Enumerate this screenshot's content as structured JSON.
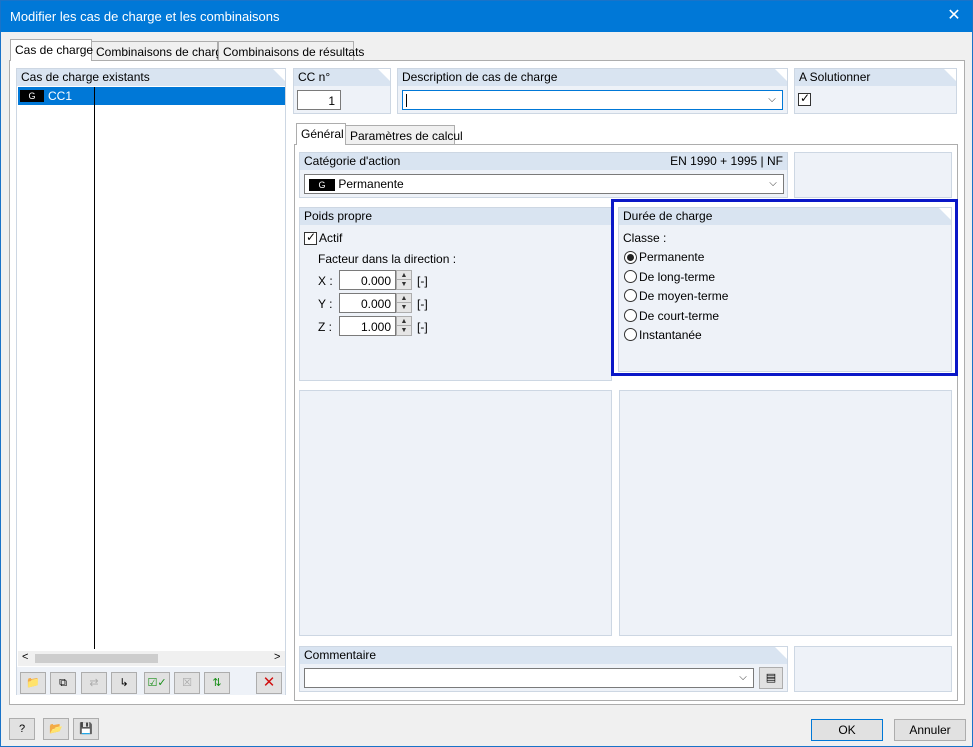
{
  "window": {
    "title": "Modifier les cas de charge et les combinaisons",
    "close_label": "✕"
  },
  "tabs": [
    {
      "label": "Cas de charge"
    },
    {
      "label": "Combinaisons de charge"
    },
    {
      "label": "Combinaisons de résultats"
    }
  ],
  "left_panel": {
    "header": "Cas de charge existants",
    "rows": [
      {
        "badge": "G",
        "name": "CC1",
        "selected": true
      }
    ],
    "scroll_left": "<",
    "scroll_right": ">"
  },
  "cc_no": {
    "label": "CC n°",
    "value": "1"
  },
  "description": {
    "label": "Description de cas de charge",
    "value": ""
  },
  "to_solve": {
    "label": "A Solutionner",
    "checked": true
  },
  "inner_tabs": [
    {
      "label": "Général"
    },
    {
      "label": "Paramètres de calcul"
    }
  ],
  "action_category": {
    "label": "Catégorie d'action",
    "norm": "EN 1990 + 1995 | NF",
    "badge": "G",
    "value": "Permanente"
  },
  "self_weight": {
    "label": "Poids propre",
    "active_label": "Actif",
    "factor_label": "Facteur dans la direction :",
    "rows": [
      {
        "axis": "X :",
        "value": "0.000",
        "unit": "[-]"
      },
      {
        "axis": "Y :",
        "value": "0.000",
        "unit": "[-]"
      },
      {
        "axis": "Z :",
        "value": "1.000",
        "unit": "[-]"
      }
    ]
  },
  "load_duration": {
    "label": "Durée de charge",
    "class_label": "Classe :",
    "options": [
      {
        "label": "Permanente",
        "selected": true
      },
      {
        "label": "De long-terme",
        "selected": false
      },
      {
        "label": "De moyen-terme",
        "selected": false
      },
      {
        "label": "De court-terme",
        "selected": false
      },
      {
        "label": "Instantanée",
        "selected": false
      }
    ],
    "highlight_color": "#0a17c7"
  },
  "comment": {
    "label": "Commentaire",
    "value": ""
  },
  "buttons": {
    "ok": "OK",
    "cancel": "Annuler"
  },
  "icons": {
    "toolbar": [
      "new-load-case-icon",
      "copy-icon",
      "renumber-icon",
      "select-icon",
      "check-all-icon",
      "uncheck-icon",
      "toggle-check-icon",
      "delete-icon"
    ],
    "footer": [
      "help-icon",
      "open-icon",
      "save-icon"
    ]
  },
  "colors": {
    "title_bar": "#0078d7",
    "selection": "#0078d7",
    "panel_header": "#d9e4f1"
  }
}
